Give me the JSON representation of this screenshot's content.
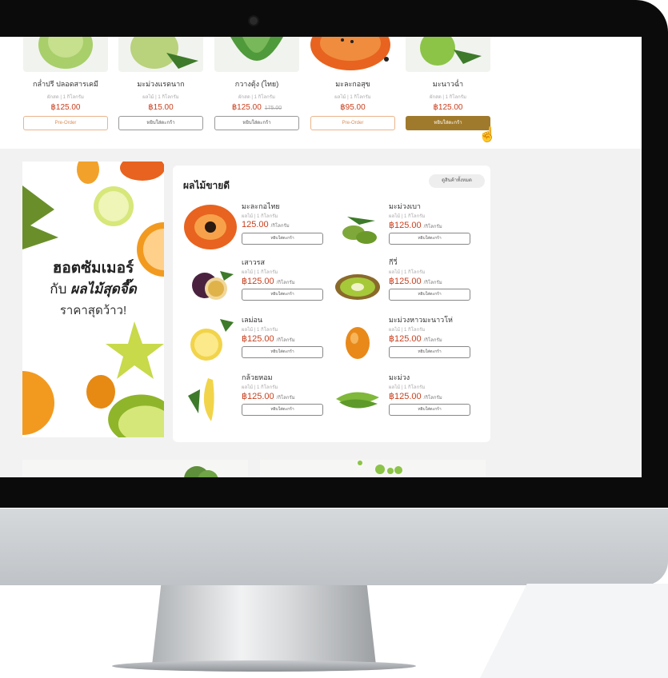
{
  "top_products": [
    {
      "name": "กล่ำปรี ปลอดสารเคมี",
      "unit": "ผักสด | 1 กิโลกรัม",
      "price": "฿125.00",
      "old_price": "",
      "button": "Pre-Order",
      "style": "pre"
    },
    {
      "name": "มะม่วงแรดนาก",
      "unit": "ผลไม้ | 1 กิโลกรัม",
      "price": "฿15.00",
      "old_price": "",
      "button": "หยิบใส่ตะกร้า",
      "style": "normal"
    },
    {
      "name": "กวางตุ้ง (ไทย)",
      "unit": "ผักสด | 1 กิโลกรัม",
      "price": "฿125.00",
      "old_price": "175.00",
      "button": "หยิบใส่ตะกร้า",
      "style": "normal"
    },
    {
      "name": "มะละกอสุข",
      "unit": "ผลไม้ | 1 กิโลกรัม",
      "price": "฿95.00",
      "old_price": "",
      "button": "Pre-Order",
      "style": "pre"
    },
    {
      "name": "มะนาวฉ่ำ",
      "unit": "ผักสด | 1 กิโลกรัม",
      "price": "฿125.00",
      "old_price": "",
      "button": "หยิบใส่ตะกร้า",
      "style": "gold"
    }
  ],
  "promo": {
    "line1": "ฮอตซัมเมอร์",
    "line2_prefix": "กับ",
    "line2_bold": "ผลไม้สุดจี๊ด",
    "line3": "ราคาสุดว้าว!"
  },
  "best_sellers": {
    "title": "ผลไม้ขายดี",
    "see_all": "ดูสินค้าทั้งหมด",
    "items": [
      {
        "name": "มะละกอไทย",
        "unit": "ผลไม้ | 1 กิโลกรัม",
        "price": "125.00",
        "per": "/กิโลกรัม",
        "button": "หยิบใส่ตะกร้า",
        "icon": "papaya-icon"
      },
      {
        "name": "มะม่วงเบา",
        "unit": "ผลไม้ | 1 กิโลกรัม",
        "price": "฿125.00",
        "per": "/กิโลกรัม",
        "button": "หยิบใส่ตะกร้า",
        "icon": "green-mango-icon"
      },
      {
        "name": "เสาวรส",
        "unit": "ผลไม้ | 1 กิโลกรัม",
        "price": "฿125.00",
        "per": "/กิโลกรัม",
        "button": "หยิบใส่ตะกร้า",
        "icon": "passionfruit-icon"
      },
      {
        "name": "กีวี่",
        "unit": "ผลไม้ | 1 กิโลกรัม",
        "price": "฿125.00",
        "per": "/กิโลกรัม",
        "button": "หยิบใส่ตะกร้า",
        "icon": "kiwi-icon"
      },
      {
        "name": "เลม่อน",
        "unit": "ผลไม้ | 1 กิโลกรัม",
        "price": "฿125.00",
        "per": "/กิโลกรัม",
        "button": "หยิบใส่ตะกร้า",
        "icon": "lemon-icon"
      },
      {
        "name": "มะม่วงหาวมะนาวโห่",
        "unit": "ผลไม้ | 1 กิโลกรัม",
        "price": "฿125.00",
        "per": "/กิโลกรัม",
        "button": "หยิบใส่ตะกร้า",
        "icon": "kumquat-icon"
      },
      {
        "name": "กล้วยหอม",
        "unit": "ผลไม้ | 1 กิโลกรัม",
        "price": "฿125.00",
        "per": "/กิโลกรัม",
        "button": "หยิบใส่ตะกร้า",
        "icon": "banana-icon"
      },
      {
        "name": "มะม่วง",
        "unit": "ผลไม้ | 1 กิโลกรัม",
        "price": "฿125.00",
        "per": "/กิโลกรัม",
        "button": "หยิบใส่ตะกร้า",
        "icon": "mango-icon"
      }
    ]
  },
  "colors": {
    "price": "#c8401f",
    "gold_button": "#a07a2c",
    "preorder": "#d98b55"
  }
}
